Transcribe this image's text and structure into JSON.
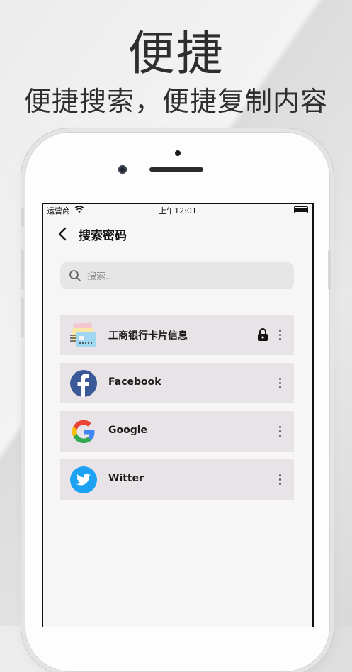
{
  "hero": {
    "title": "便捷",
    "subtitle": "便捷搜索，便捷复制内容"
  },
  "status_bar": {
    "carrier": "运营商",
    "time": "上午12:01"
  },
  "header": {
    "title": "搜索密码"
  },
  "search": {
    "placeholder": "搜索..."
  },
  "items": [
    {
      "label": "工商银行卡片信息",
      "icon": "bank-card-icon",
      "locked": true
    },
    {
      "label": "Facebook",
      "icon": "facebook-icon",
      "locked": false
    },
    {
      "label": "Google",
      "icon": "google-icon",
      "locked": false
    },
    {
      "label": "Witter",
      "icon": "twitter-icon",
      "locked": false
    }
  ],
  "colors": {
    "item_bg": "#e7e3e7",
    "facebook": "#3b5998",
    "twitter": "#1da1f2",
    "google_blue": "#4285f4",
    "google_red": "#ea4335",
    "google_yellow": "#fbbc05",
    "google_green": "#34a853"
  }
}
